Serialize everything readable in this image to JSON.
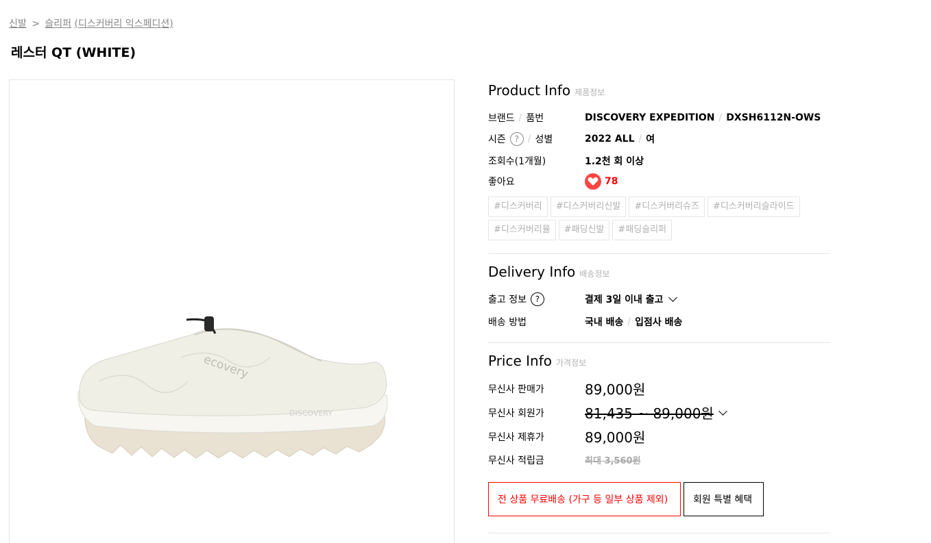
{
  "breadcrumb": {
    "level1": "신발",
    "separator": ">",
    "level2": "슬리퍼",
    "level3": "(디스커버리 익스페디션)"
  },
  "product_title": "레스터 QT (WHITE)",
  "product_info": {
    "heading": "Product Info",
    "heading_sub": "제품정보",
    "brand_label_a": "브랜드",
    "brand_label_b": "품번",
    "brand": "DISCOVERY EXPEDITION",
    "product_code": "DXSH6112N-OWS",
    "season_label_a": "시즌",
    "season_label_b": "성별",
    "season": "2022 ALL",
    "gender": "여",
    "views_label": "조회수(1개월)",
    "views": "1.2천 회 이상",
    "likes_label": "좋아요",
    "likes": "78",
    "question_glyph": "?",
    "tags": [
      "#디스커버리",
      "#디스커버리신발",
      "#디스커버리슈즈",
      "#디스커버리슬라이드",
      "#디스커버리뮬",
      "#패딩신발",
      "#패딩슬리퍼"
    ]
  },
  "delivery_info": {
    "heading": "Delivery Info",
    "heading_sub": "배송정보",
    "shipping_label": "출고 정보",
    "shipping": "결제 3일 이내 출고",
    "method_label": "배송 방법",
    "method_a": "국내 배송",
    "method_b": "입점사 배송"
  },
  "price_info": {
    "heading": "Price Info",
    "heading_sub": "가격정보",
    "sale_label": "무신사 판매가",
    "sale_price": "89,000원",
    "member_label": "무신사 회원가",
    "member_price": "81,435 ~ 89,000원",
    "partner_label": "무신사 제휴가",
    "partner_price": "89,000원",
    "points_label": "무신사 적립금",
    "points": "최대 3,560원"
  },
  "buttons": {
    "free_shipping": "전 상품 무료배송 (가구 등 일부 상품 제외)",
    "member_benefit": "회원 특별 혜택"
  },
  "colors": {
    "accent_red": "#ff0000",
    "heart": "#ff4444",
    "border": "#e5e5e5",
    "muted_text": "#b0b0b0"
  }
}
